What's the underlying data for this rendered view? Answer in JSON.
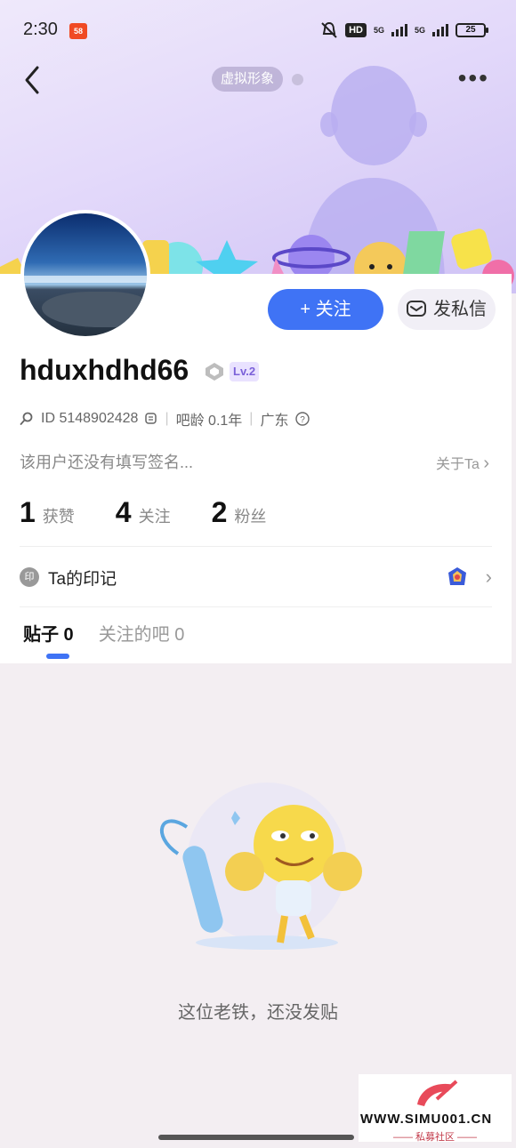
{
  "status_bar": {
    "time": "2:30",
    "app_badge": "58",
    "hd_label": "HD",
    "signal1_label": "5G",
    "signal2_label": "5G",
    "battery": "25"
  },
  "header": {
    "avatar_tag": "虚拟形象",
    "more_label": "•••"
  },
  "profile": {
    "follow_label": "+ 关注",
    "message_label": "发私信",
    "username": "hduxhdhd66",
    "level": "Lv.2",
    "id_text": "ID 5148902428",
    "bar_age": "吧龄 0.1年",
    "location": "广东",
    "signature": "该用户还没有填写签名...",
    "about_label": "关于Ta"
  },
  "stats": [
    {
      "num": "1",
      "label": "获赞"
    },
    {
      "num": "4",
      "label": "关注"
    },
    {
      "num": "2",
      "label": "粉丝"
    }
  ],
  "mark": {
    "icon_text": "印",
    "label": "Ta的印记"
  },
  "tabs": [
    {
      "label": "贴子 0",
      "active": true
    },
    {
      "label": "关注的吧 0",
      "active": false
    }
  ],
  "empty": {
    "text": "这位老铁，还没发贴"
  },
  "watermark": {
    "url": "WWW.SIMU001.CN",
    "sub": "—— 私募社区 ——"
  },
  "colors": {
    "accent": "#3f73f5",
    "level_bg": "#e9e2ff",
    "level_fg": "#7b61d9"
  }
}
